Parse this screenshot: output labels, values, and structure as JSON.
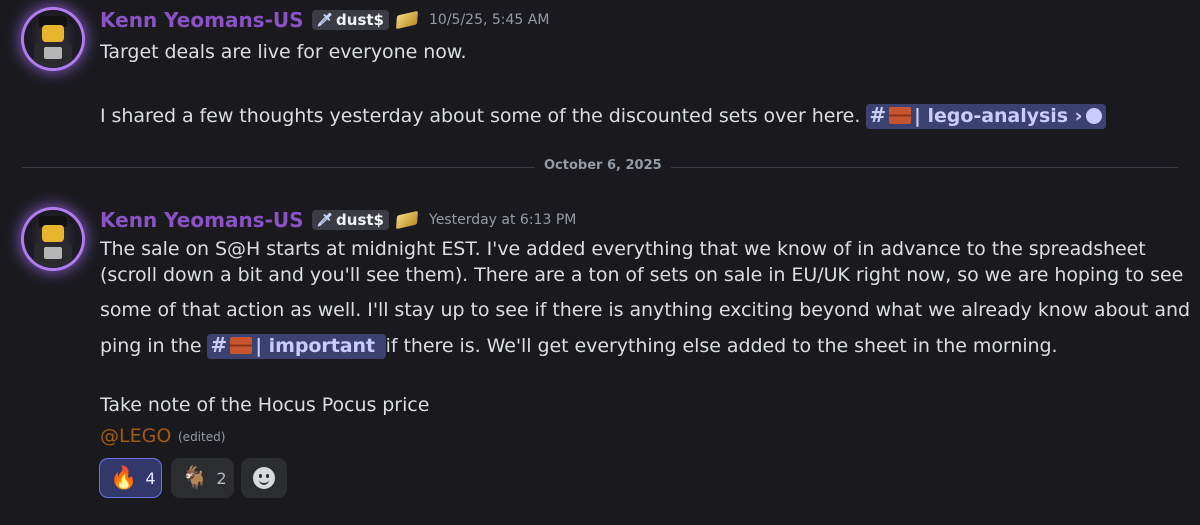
{
  "messages": [
    {
      "username": "Kenn Yeomans-US",
      "tag_label": "dust$",
      "tag_icon": "sword-icon",
      "timestamp": "10/5/25, 5:45 AM",
      "lines": [
        "Target deals are live for everyone now.",
        "I shared a few thoughts yesterday about some of the discounted sets over here."
      ],
      "channel": {
        "hash": "#",
        "separator": "|",
        "name": "lego-analysis",
        "chevron": "›"
      }
    },
    {
      "username": "Kenn Yeomans-US",
      "tag_label": "dust$",
      "tag_icon": "sword-icon",
      "timestamp": "Yesterday at 6:13 PM",
      "lines": [
        "The sale on S@H starts at midnight EST. I've added everything that we know of in advance to the spreadsheet",
        "(scroll down a bit and you'll see them). There are a ton of sets on sale in EU/UK right now, so we are hoping to see",
        "some of that action as well. I'll stay up to see if there is anything exciting  beyond what we already know about and",
        "ping in the",
        "if there is. We'll get everything else added to the sheet in the morning.",
        "Take note of the Hocus Pocus price"
      ],
      "channel": {
        "hash": "#",
        "separator": "|",
        "name": "important"
      },
      "mention": "@LEGO",
      "edited": "(edited)",
      "reactions": [
        {
          "emoji": "🔥",
          "count": "4",
          "active": true
        },
        {
          "emoji": "🐐",
          "count": "2",
          "active": false
        }
      ]
    }
  ],
  "divider_date": "October 6, 2025",
  "colors": {
    "username": "#8a52c4",
    "channel_bg": "#3c4270",
    "mention": "#a35a14",
    "background": "#1a1a1e"
  }
}
